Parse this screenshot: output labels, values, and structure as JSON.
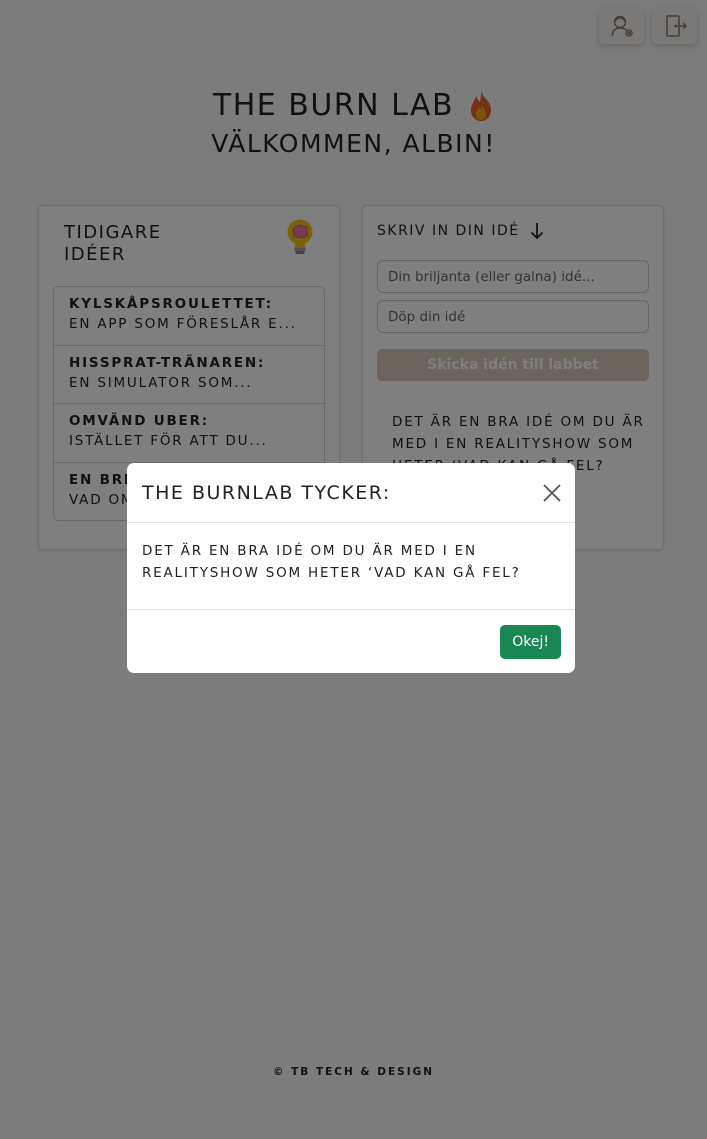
{
  "header": {
    "title": "THE BURN LAB",
    "flame_icon": "flame-icon",
    "welcome": "VÄLKOMMEN, ALBIN!"
  },
  "toolbar": {
    "profile_icon": "user-settings-icon",
    "logout_icon": "logout-door-icon"
  },
  "previous_ideas": {
    "heading": "TIDIGARE IDÉER",
    "icon": "brain-lightbulb-icon",
    "items": [
      {
        "name": "KYLSKÅPSROULETTET",
        "desc": "EN APP SOM FÖRESLÅR E..."
      },
      {
        "name": "HISSPRAT-TRÄNAREN",
        "desc": "EN SIMULATOR SOM..."
      },
      {
        "name": "OMVÄND UBER",
        "desc": "ISTÄLLET FÖR ATT DU..."
      },
      {
        "name": "EN BRI",
        "desc": "VAD OM"
      }
    ]
  },
  "new_idea": {
    "heading": "SKRIV IN DIN IDÉ",
    "arrow_icon": "arrow-down-icon",
    "idea_placeholder": "Din briljanta (eller galna) idé...",
    "name_placeholder": "Döp din idé",
    "submit_label": "Skicka idén till labbet",
    "verdict_text": "DET ÄR EN BRA IDÉ OM DU ÄR MED I EN REALITYSHOW SOM HETER ‘VAD KAN GÅ FEL?"
  },
  "footer": {
    "text": "© TB TECH & DESIGN"
  },
  "modal": {
    "title": "THE BURNLAB TYCKER:",
    "body": "DET ÄR EN BRA IDÉ OM DU ÄR MED I EN REALITYSHOW SOM HETER ‘VAD KAN GÅ FEL?",
    "ok_label": "Okej!"
  },
  "colors": {
    "ok_button": "#198754",
    "submit_button_disabled": "#d8cbbd",
    "backdrop": "rgba(0,0,0,0.5)"
  }
}
